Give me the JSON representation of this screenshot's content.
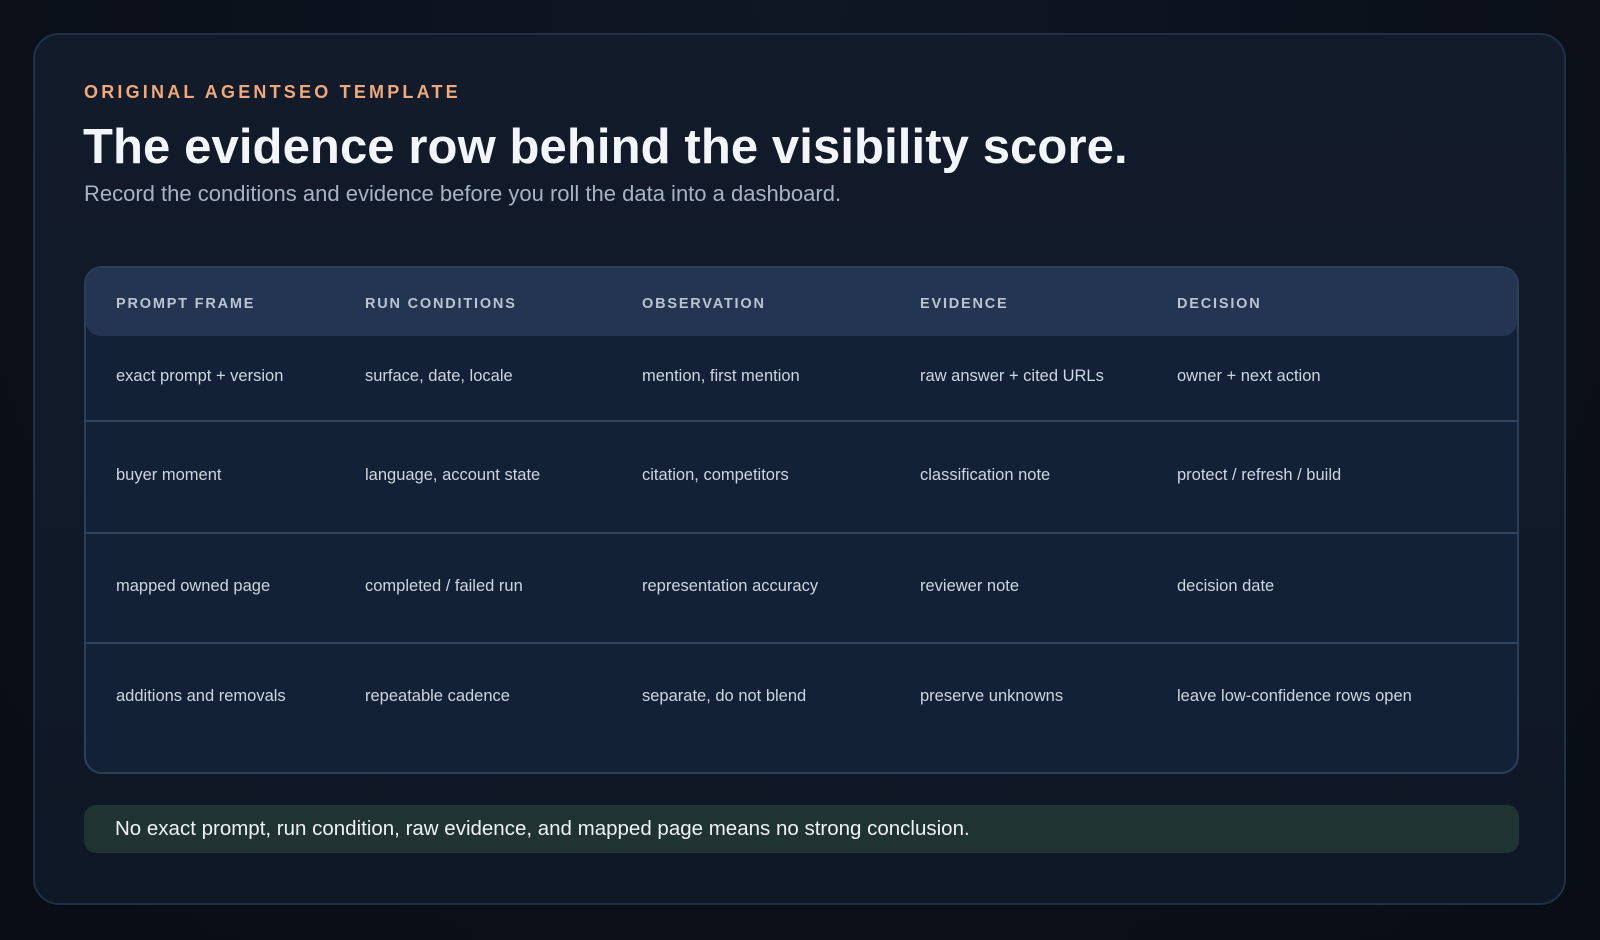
{
  "eyebrow": "ORIGINAL AGENTSEO TEMPLATE",
  "title": "The evidence row behind the visibility score.",
  "subtitle": "Record the conditions and evidence before you roll the data into a dashboard.",
  "table": {
    "headers": [
      "PROMPT FRAME",
      "RUN CONDITIONS",
      "OBSERVATION",
      "EVIDENCE",
      "DECISION"
    ],
    "rows": [
      [
        "exact prompt + version",
        "surface, date, locale",
        "mention, first mention",
        "raw answer + cited URLs",
        "owner + next action"
      ],
      [
        "buyer moment",
        "language, account state",
        "citation, competitors",
        "classification note",
        "protect / refresh / build"
      ],
      [
        "mapped owned page",
        "completed / failed run",
        "representation accuracy",
        "reviewer note",
        "decision date"
      ],
      [
        "additions and removals",
        "repeatable cadence",
        "separate, do not blend",
        "preserve unknowns",
        "leave low-confidence rows open"
      ]
    ]
  },
  "footnote": "No exact prompt, run condition, raw evidence, and mapped page means no strong conclusion.",
  "colors": {
    "eyebrow": "#f2a878",
    "background": "#0a0f18",
    "card": "#121b2a",
    "table_header": "#233551",
    "footnote_bg": "#1f3331"
  }
}
